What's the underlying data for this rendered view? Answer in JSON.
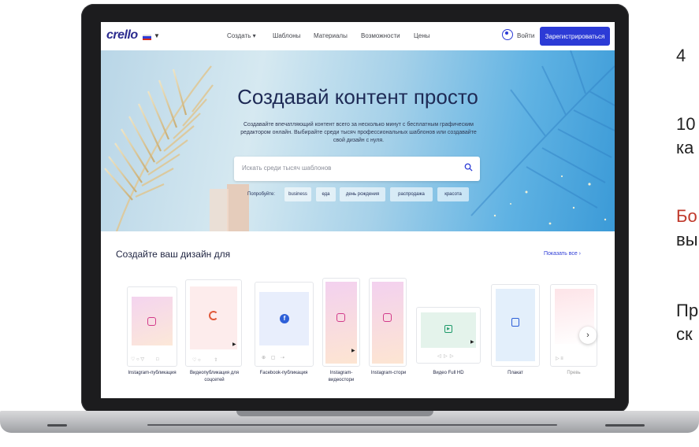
{
  "side_text": {
    "line1": "4",
    "line2a": "10",
    "line2b": "ка",
    "line3a": "Бо",
    "line3b": "вы",
    "line4a": "Пр",
    "line4b": "ск"
  },
  "header": {
    "logo": "crello",
    "nav": [
      "Создать ▾",
      "Шаблоны",
      "Материалы",
      "Возможности",
      "Цены"
    ],
    "login": "Войти",
    "signup": "Зарегистрироваться"
  },
  "hero": {
    "title": "Создавай контент просто",
    "subtitle": "Создавайте впечатляющий контент всего за несколько минут с бесплатным графическим редактором онлайн. Выбирайте среди тысяч профессиональных шаблонов или создавайте свой дизайн с нуля.",
    "search_placeholder": "Искать среди тысяч шаблонов",
    "try_label": "Попробуйте:",
    "chips": [
      "business",
      "еда",
      "день рождения",
      "распродажа",
      "красота"
    ]
  },
  "section": {
    "title": "Создайте ваш дизайн для",
    "show_all": "Показать все ›",
    "cards": [
      {
        "label": "Instagram-публикация",
        "icon": "instagram-icon"
      },
      {
        "label": "Видеопубликация для соцсетей",
        "icon": "refresh-icon"
      },
      {
        "label": "Facebook-публикация",
        "icon": "facebook-icon"
      },
      {
        "label": "Instagram-видеостори",
        "icon": "instagram-icon"
      },
      {
        "label": "Instagram-стори",
        "icon": "instagram-icon"
      },
      {
        "label": "Видео Full HD",
        "icon": "video-icon"
      },
      {
        "label": "Плакат",
        "icon": "poster-icon"
      },
      {
        "label": "Превь",
        "icon": ""
      }
    ]
  },
  "colors": {
    "accent": "#2c3bd6",
    "laptop": "#1c1c1e",
    "highlight_text": "#c0392b"
  }
}
